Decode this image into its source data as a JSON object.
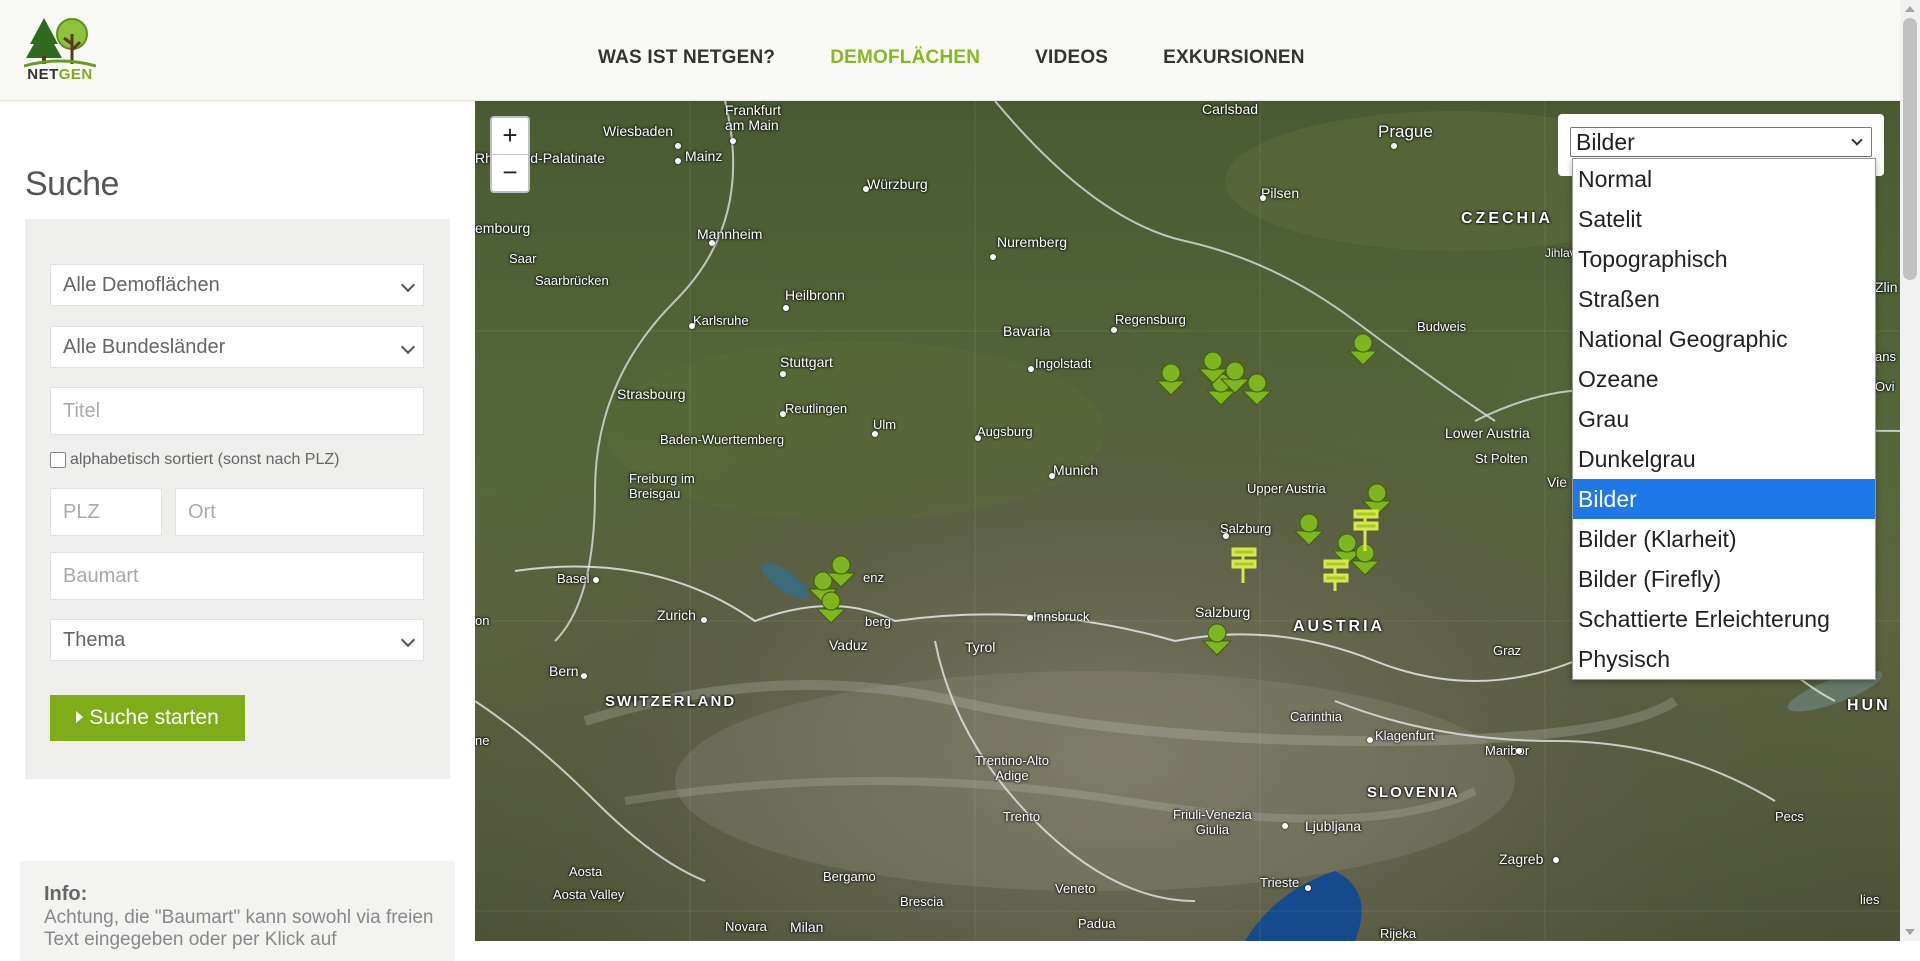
{
  "header": {
    "logo_text_a": "NET",
    "logo_text_b": "GEN",
    "nav": [
      {
        "label": "WAS IST NETGEN?",
        "active": false
      },
      {
        "label": "DEMOFLÄCHEN",
        "active": true
      },
      {
        "label": "VIDEOS",
        "active": false
      },
      {
        "label": "EXKURSIONEN",
        "active": false
      }
    ]
  },
  "sidebar": {
    "title": "Suche",
    "demo_select": "Alle Demoflächen",
    "state_select": "Alle Bundesländer",
    "title_placeholder": "Titel",
    "sort_label": "alphabetisch sortiert (sonst nach PLZ)",
    "plz_placeholder": "PLZ",
    "ort_placeholder": "Ort",
    "baumart_placeholder": "Baumart",
    "thema_select": "Thema",
    "submit_label": "Suche starten",
    "info_title": "Info:",
    "info_text": "Achtung, die \"Baumart\" kann sowohl via freien Text eingegeben oder per Klick auf"
  },
  "map": {
    "zoom_in": "+",
    "zoom_out": "−",
    "layer_selected": "Bilder",
    "layer_options": [
      "Normal",
      "Satelit",
      "Topographisch",
      "Straßen",
      "National Geographic",
      "Ozeane",
      "Grau",
      "Dunkelgrau",
      "Bilder",
      "Bilder (Klarheit)",
      "Bilder (Firefly)",
      "Schattierte Erleichterung",
      "Physisch"
    ],
    "labels": {
      "frankfurt": "Frankfurt\nam Main",
      "wiesbaden": "Wiesbaden",
      "mainz": "Mainz",
      "rhineland": "Rhineland-Palatinate",
      "wurzburg": "Würzburg",
      "carlsbad": "Carlsbad",
      "prague": "Prague",
      "pilsen": "Pilsen",
      "czechia": "CZECHIA",
      "jihlava": "Jihlava",
      "zlin": "Zlin",
      "luxembourg": "embourg",
      "saar": "Saar",
      "mannheim": "Mannheim",
      "nuremberg": "Nuremberg",
      "saarbrucken": "Saarbrücken",
      "heilbronn": "Heilbronn",
      "karlsruhe": "Karlsruhe",
      "bavaria": "Bavaria",
      "regensburg": "Regensburg",
      "budweis": "Budweis",
      "stuttgart": "Stuttgart",
      "ingolstadt": "Ingolstadt",
      "strasbourg": "Strasbourg",
      "reutlingen": "Reutlingen",
      "bw": "Baden-Wuerttemberg",
      "ulm": "Ulm",
      "augsburg": "Augsburg",
      "lower_austria": "Lower Austria",
      "st_polten": "St Polten",
      "freiburg": "Freiburg im\nBreisgau",
      "munich": "Munich",
      "upper_austria": "Upper Austria",
      "salzburg": "Salzburg",
      "basel": "Basel",
      "bregenz": "enz",
      "zurich": "Zurich",
      "liechtenstein": "berg",
      "vaduz": "Vaduz",
      "innsbruck": "Innsbruck",
      "salzburg2": "Salzburg",
      "austria": "AUSTRIA",
      "tyrol": "Tyrol",
      "graz": "Graz",
      "bern": "Bern",
      "switzerland": "SWITZERLAND",
      "carinthia": "Carinthia",
      "klagenfurt": "Klagenfurt",
      "maribor": "Maribor",
      "slovenia": "SLOVENIA",
      "hungary": "HUN",
      "trentino": "Trentino-Alto\nAdige",
      "trento": "Trento",
      "friuli": "Friuli-Venezia\nGiulia",
      "ljubljana": "Ljubljana",
      "pecs": "Pecs",
      "zagreb": "Zagreb",
      "aosta": "Aosta",
      "aosta_valley": "Aosta Valley",
      "bergamo": "Bergamo",
      "brescia": "Brescia",
      "veneto": "Veneto",
      "trieste": "Trieste",
      "novara": "Novara",
      "milan": "Milan",
      "padua": "Padua",
      "rijeka": "Rijeka",
      "lies": "lies",
      "ne": "ne",
      "on": "on",
      "zlin2": "Zlin",
      "ans": "ans",
      "vie": "Vie",
      "ovi": "Ovi"
    }
  },
  "colors": {
    "accent": "#7fad1a",
    "nav_active": "#86b81f",
    "selected_option": "#1e78e8"
  }
}
